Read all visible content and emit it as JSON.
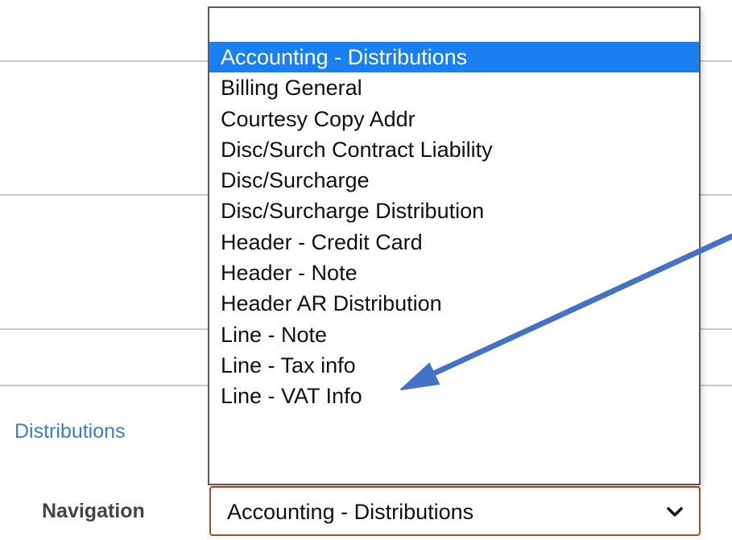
{
  "background": {
    "link_text": "Distributions"
  },
  "navigation": {
    "label": "Navigation",
    "selected_value": "Accounting - Distributions"
  },
  "dropdown": {
    "selected_index": 0,
    "options": [
      "Accounting - Distributions",
      "Billing General",
      "Courtesy Copy Addr",
      "Disc/Surch Contract Liability",
      "Disc/Surcharge",
      "Disc/Surcharge  Distribution",
      "Header - Credit Card",
      "Header - Note",
      "Header AR Distribution",
      "Line - Note",
      "Line - Tax info",
      "Line - VAT Info"
    ]
  },
  "colors": {
    "selection": "#1a7ff0",
    "select_border": "#a0522d",
    "link": "#3a7fc1",
    "annotation_arrow": "#4472c4"
  },
  "icons": {
    "select_toggle": "chevron-down-icon",
    "annotation": "arrow-icon"
  }
}
